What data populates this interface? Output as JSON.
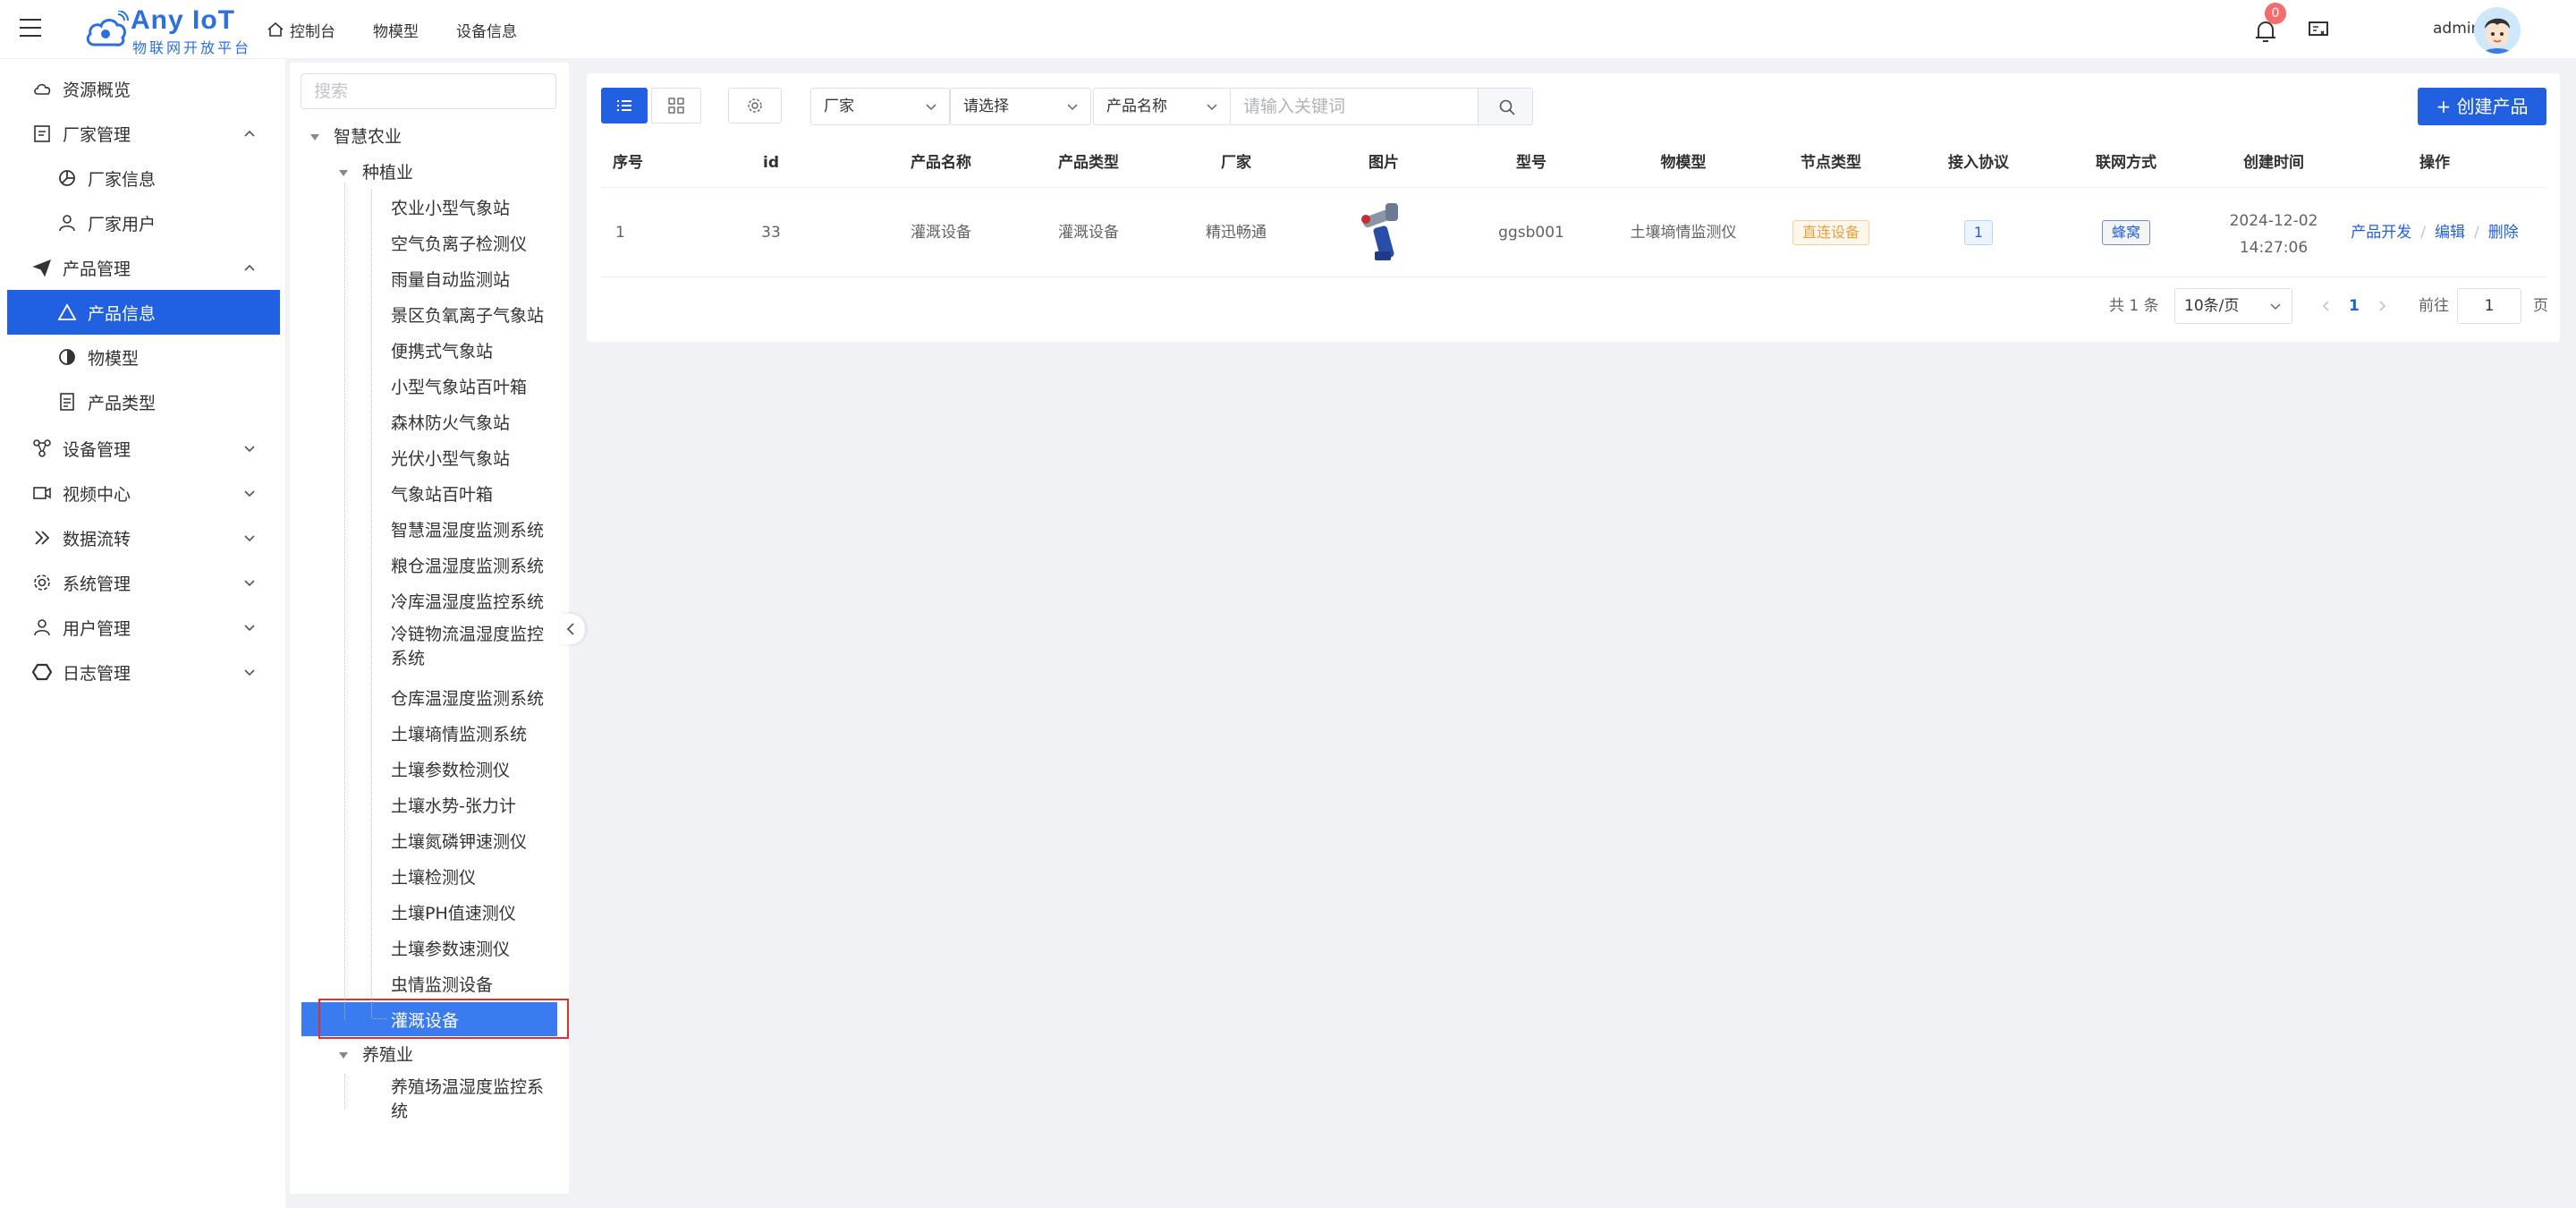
{
  "header": {
    "logo_title": "Any IoT",
    "logo_subtitle": "物联网开放平台",
    "nav": [
      {
        "label": "控制台",
        "icon": "home-icon"
      },
      {
        "label": "物模型"
      },
      {
        "label": "设备信息"
      }
    ],
    "notification_count": "0",
    "user": "admin"
  },
  "sidebar": {
    "items": [
      {
        "label": "资源概览",
        "icon": "cloud-icon"
      },
      {
        "label": "厂家管理",
        "icon": "clipboard-icon",
        "expanded": true
      },
      {
        "label": "厂家信息",
        "icon": "pie-icon"
      },
      {
        "label": "厂家用户",
        "icon": "user-icon"
      },
      {
        "label": "产品管理",
        "icon": "send-icon",
        "expanded": true
      },
      {
        "label": "产品信息",
        "icon": "triangle-icon",
        "active": true
      },
      {
        "label": "物模型",
        "icon": "half-circle-icon"
      },
      {
        "label": "产品类型",
        "icon": "document-icon"
      },
      {
        "label": "设备管理",
        "icon": "device-icon"
      },
      {
        "label": "视频中心",
        "icon": "video-icon"
      },
      {
        "label": "数据流转",
        "icon": "double-chevron-icon"
      },
      {
        "label": "系统管理",
        "icon": "gear-icon"
      },
      {
        "label": "用户管理",
        "icon": "user-icon"
      },
      {
        "label": "日志管理",
        "icon": "hexagon-icon"
      }
    ]
  },
  "tree": {
    "search_placeholder": "搜索",
    "root": "智慧农业",
    "group1": "种植业",
    "group1_items": [
      "农业小型气象站",
      "空气负离子检测仪",
      "雨量自动监测站",
      "景区负氧离子气象站",
      "便携式气象站",
      "小型气象站百叶箱",
      "森林防火气象站",
      "光伏小型气象站",
      "气象站百叶箱",
      "智慧温湿度监测系统",
      "粮仓温湿度监测系统",
      "冷库温湿度监控系统",
      "冷链物流温湿度监控系统",
      "仓库温湿度监测系统",
      "土壤墒情监测系统",
      "土壤参数检测仪",
      "土壤水势-张力计",
      "土壤氮磷钾速测仪",
      "土壤检测仪",
      "土壤PH值速测仪",
      "土壤参数速测仪",
      "虫情监测设备",
      "灌溉设备"
    ],
    "selected": "灌溉设备",
    "group2": "养殖业",
    "group2_items": [
      "养殖场温湿度监控系统"
    ]
  },
  "toolbar": {
    "vendor_select": "厂家",
    "type_select": "请选择",
    "field_select": "产品名称",
    "search_placeholder": "请输入关键词",
    "create_label": "+ 创建产品"
  },
  "table": {
    "columns": [
      "序号",
      "id",
      "产品名称",
      "产品类型",
      "厂家",
      "图片",
      "型号",
      "物模型",
      "节点类型",
      "接入协议",
      "联网方式",
      "创建时间",
      "操作"
    ],
    "rows": [
      {
        "index": "1",
        "id": "33",
        "name": "灌溉设备",
        "type": "灌溉设备",
        "vendor": "精迅畅通",
        "model": "ggsb001",
        "thing_model": "土壤墒情监测仪",
        "node_type": "直连设备",
        "protocol": "1",
        "network": "蜂窝",
        "date": "2024-12-02",
        "time": "14:27:06",
        "ops": [
          "产品开发",
          "编辑",
          "删除"
        ]
      }
    ]
  },
  "pagination": {
    "total": "共 1 条",
    "page_size": "10条/页",
    "current_page": "1",
    "goto_label": "前往",
    "goto_value": "1",
    "page_suffix": "页"
  }
}
